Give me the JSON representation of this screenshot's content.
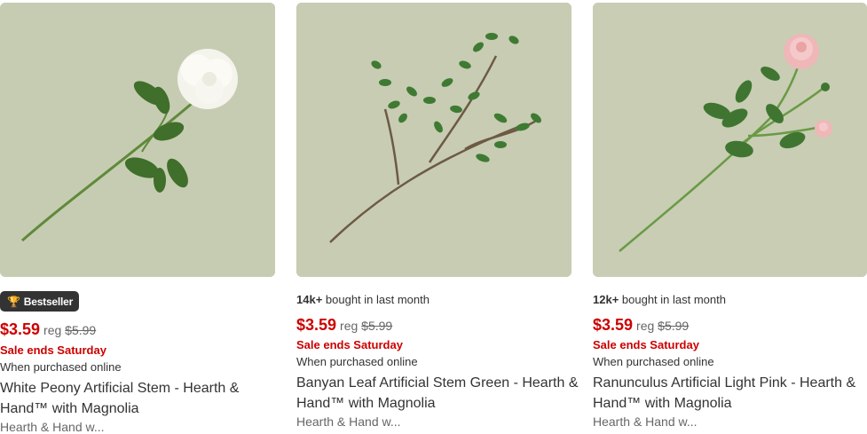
{
  "products": [
    {
      "badge": "Bestseller",
      "badge_icon": "trophy-icon",
      "bought_count": "",
      "bought_text": "",
      "price": "$3.59",
      "reg_label": "reg",
      "was_price": "$5.99",
      "sale_text": "Sale ends Saturday",
      "purchase_note": "When purchased online",
      "title": "White Peony Artificial Stem - Hearth & Hand™ with Magnolia",
      "brand": "Hearth & Hand w..."
    },
    {
      "badge": "",
      "bought_count": "14k+",
      "bought_text": " bought in last month",
      "price": "$3.59",
      "reg_label": "reg",
      "was_price": "$5.99",
      "sale_text": "Sale ends Saturday",
      "purchase_note": "When purchased online",
      "title": "Banyan Leaf Artificial Stem Green - Hearth & Hand™ with Magnolia",
      "brand": "Hearth & Hand w..."
    },
    {
      "badge": "",
      "bought_count": "12k+",
      "bought_text": " bought in last month",
      "price": "$3.59",
      "reg_label": "reg",
      "was_price": "$5.99",
      "sale_text": "Sale ends Saturday",
      "purchase_note": "When purchased online",
      "title": "Ranunculus Artificial Light Pink - Hearth & Hand™ with Magnolia",
      "brand": "Hearth & Hand w..."
    }
  ],
  "colors": {
    "sale_red": "#cc0000",
    "image_bg": "#c5cbb0",
    "badge_bg": "#333333"
  }
}
